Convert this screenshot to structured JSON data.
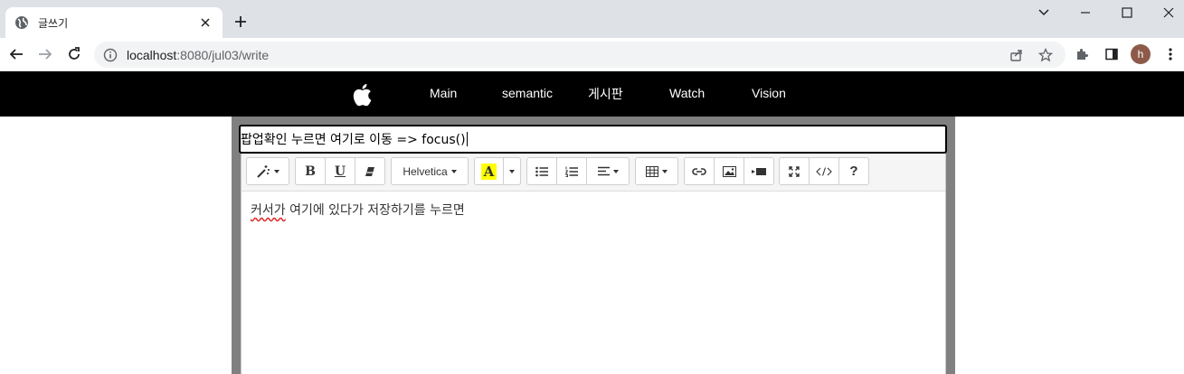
{
  "browser": {
    "tab_title": "글쓰기",
    "url_host": "localhost",
    "url_rest": ":8080/jul03/write",
    "profile_initial": "h"
  },
  "nav": {
    "items": [
      {
        "label": "Main"
      },
      {
        "label": "semantic"
      },
      {
        "label": "게시판"
      },
      {
        "label": "Watch"
      },
      {
        "label": "Vision"
      }
    ]
  },
  "editor": {
    "title_value": "팝업확인 누르면 여기로 이동 => focus()",
    "font_name": "Helvetica",
    "content_underlined": "커서가",
    "content_rest": " 여기에 있다가 저장하기를 누르면",
    "help_label": "?"
  },
  "colors": {
    "nav_bg": "#000000",
    "frame_bg": "#808080",
    "highlight": "#ffff00"
  }
}
